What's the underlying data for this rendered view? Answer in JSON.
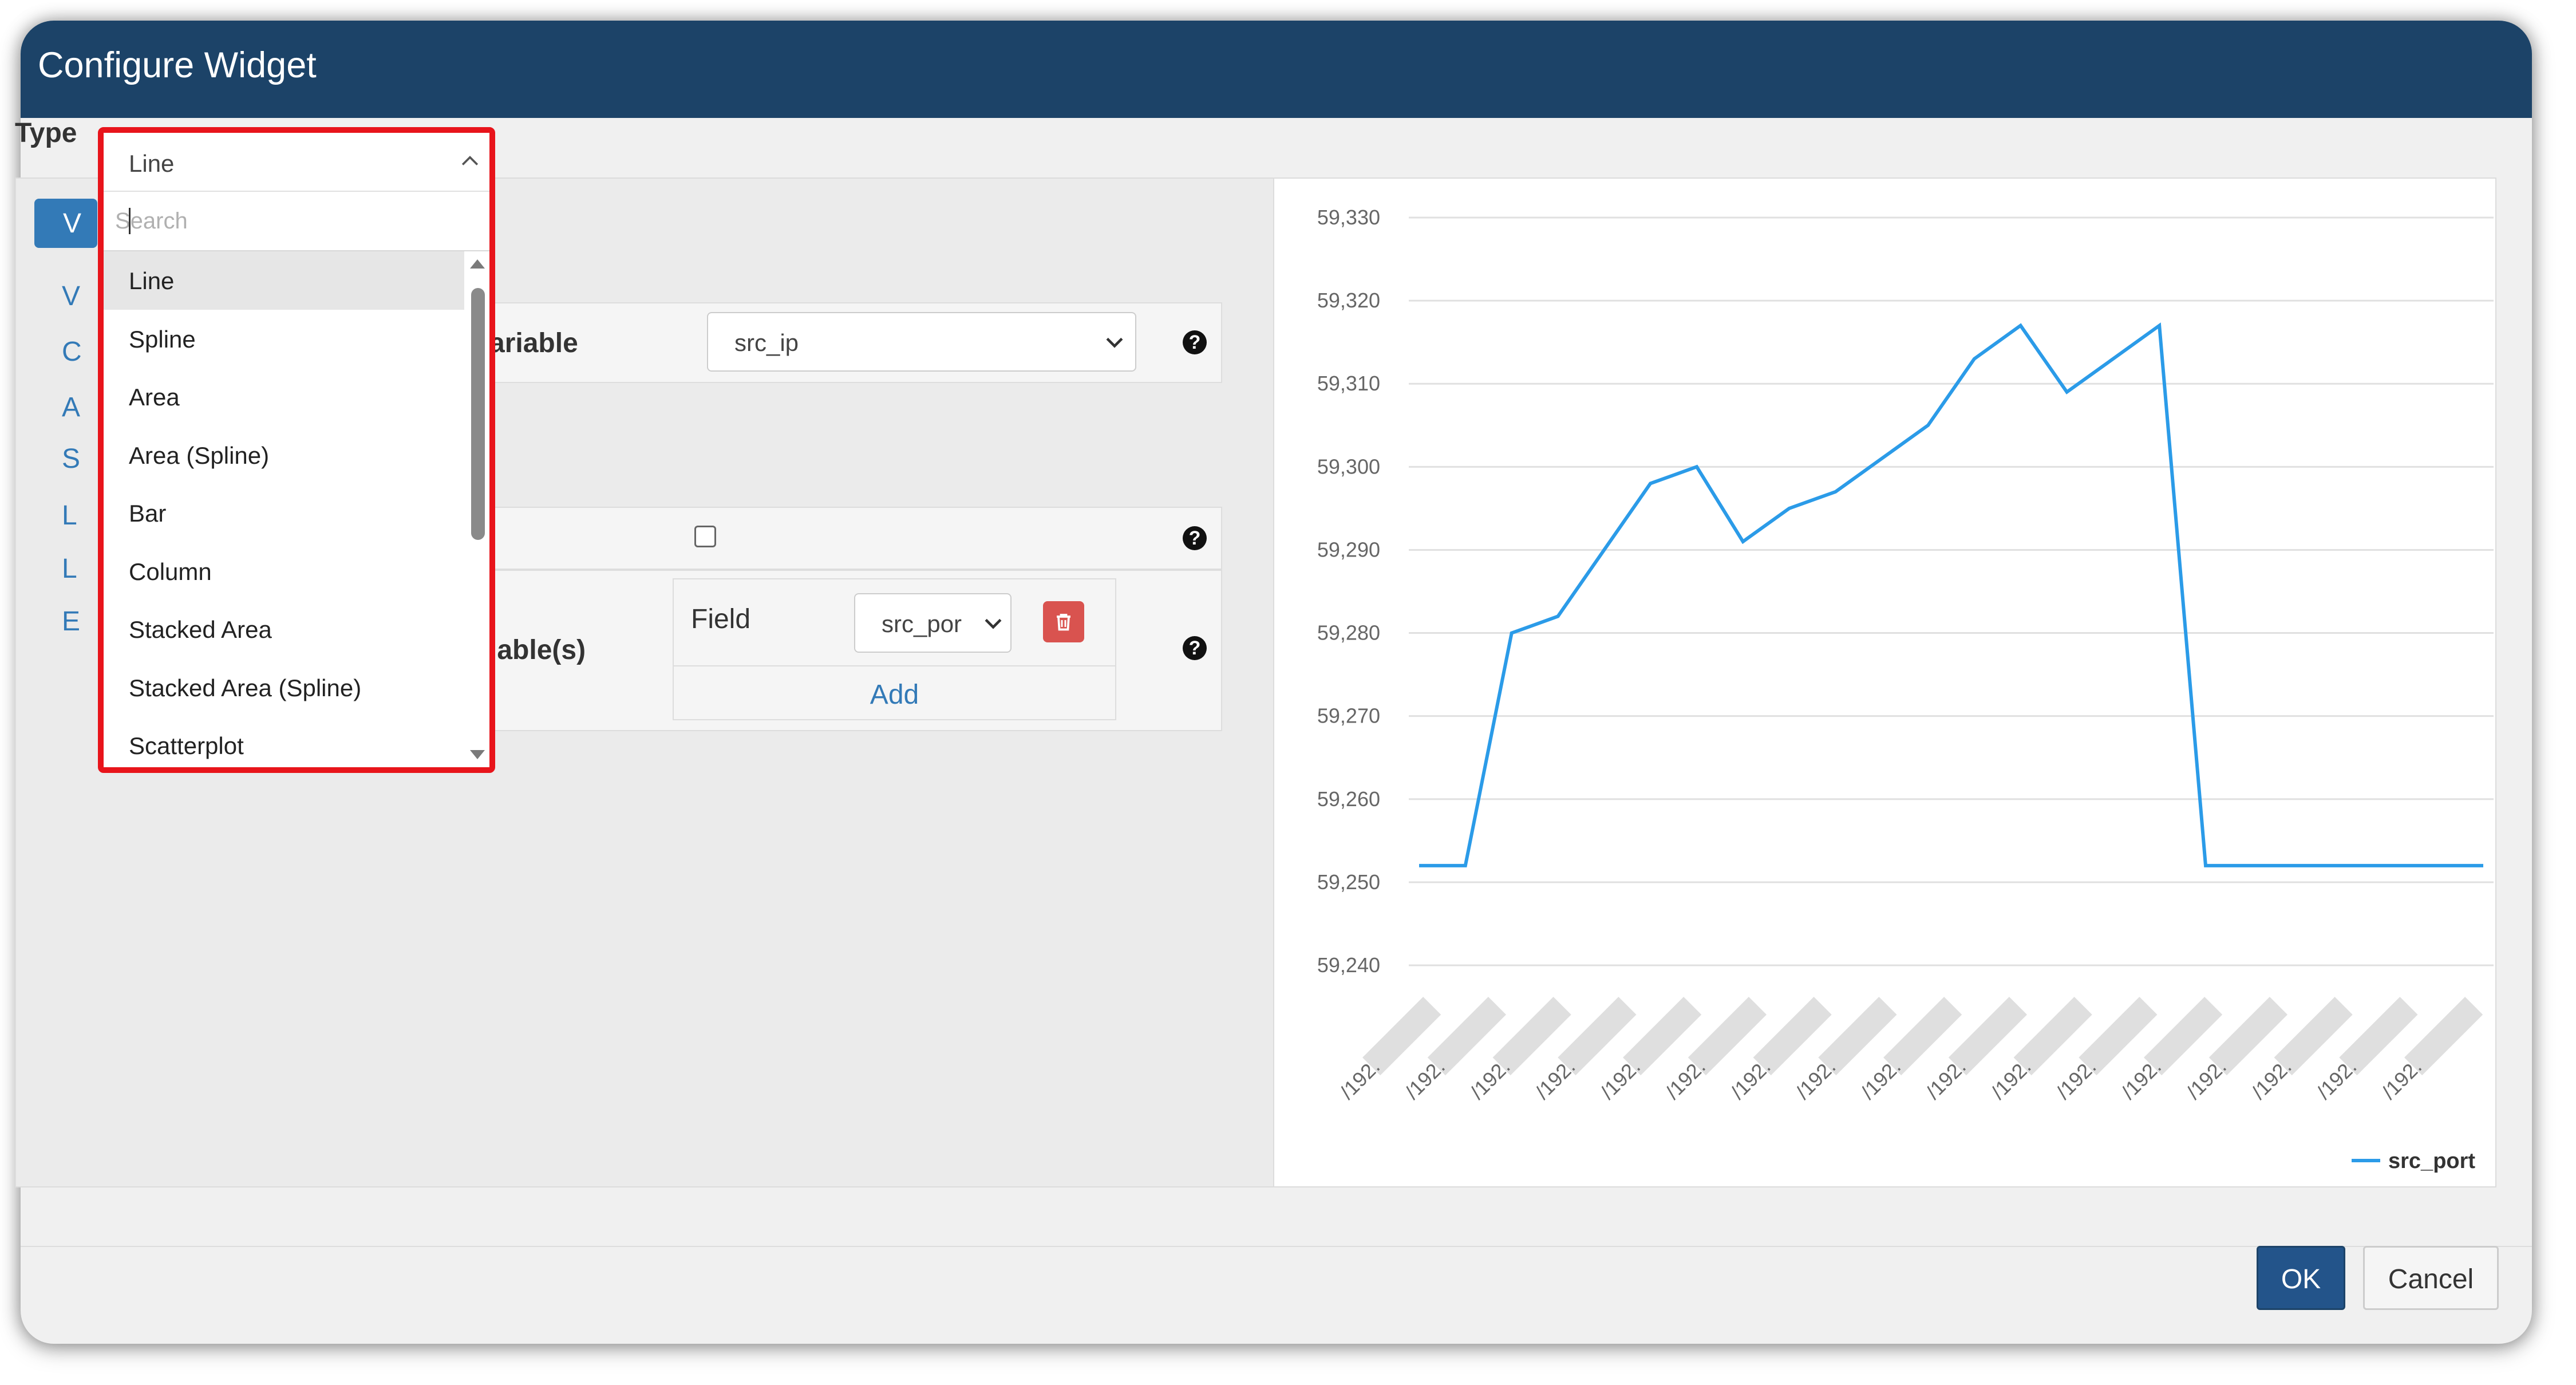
{
  "modal": {
    "title": "Configure Widget"
  },
  "type_field": {
    "label": "Type",
    "selected": "Line",
    "search_placeholder": "Search",
    "options": [
      "Line",
      "Spline",
      "Area",
      "Area (Spline)",
      "Bar",
      "Column",
      "Stacked Area",
      "Stacked Area (Spline)",
      "Scatterplot"
    ]
  },
  "sidebar": {
    "items": [
      "V",
      "V",
      "C",
      "A",
      "S",
      "L",
      "L",
      "E"
    ]
  },
  "form": {
    "variable_label": "ariable",
    "variable_value": "src_ip",
    "variables_label": "iable(s)",
    "field_label": "Field",
    "field_value": "src_por",
    "add_label": "Add"
  },
  "footer": {
    "ok_label": "OK",
    "cancel_label": "Cancel"
  },
  "colors": {
    "header": "#1c4368",
    "accent": "#337ab7",
    "highlight": "#e8141b",
    "line": "#2b9be8",
    "danger": "#d9534f"
  },
  "icons": {
    "help": "question-circle-icon",
    "trash": "trash-icon",
    "chevron": "chevron-down-icon"
  },
  "chart_data": {
    "type": "line",
    "ylim": [
      59240,
      59330
    ],
    "yticks": [
      "59,330",
      "59,320",
      "59,310",
      "59,300",
      "59,290",
      "59,280",
      "59,270",
      "59,260",
      "59,250",
      "59,240"
    ],
    "x_labels": [
      "/192.",
      "/192.",
      "/192.",
      "/192.",
      "/192.",
      "/192.",
      "/192.",
      "/192.",
      "/192.",
      "/192.",
      "/192.",
      "/192.",
      "/192.",
      "/192.",
      "/192.",
      "/192.",
      "/192."
    ],
    "series": [
      {
        "name": "src_port",
        "values": [
          59252,
          59252,
          59280,
          59282,
          59290,
          59298,
          59300,
          59291,
          59295,
          59297,
          59301,
          59305,
          59313,
          59317,
          59309,
          59313,
          59317,
          59252,
          59252,
          59252,
          59252,
          59252,
          59252,
          59252
        ]
      }
    ],
    "legend": "bottom-right"
  }
}
